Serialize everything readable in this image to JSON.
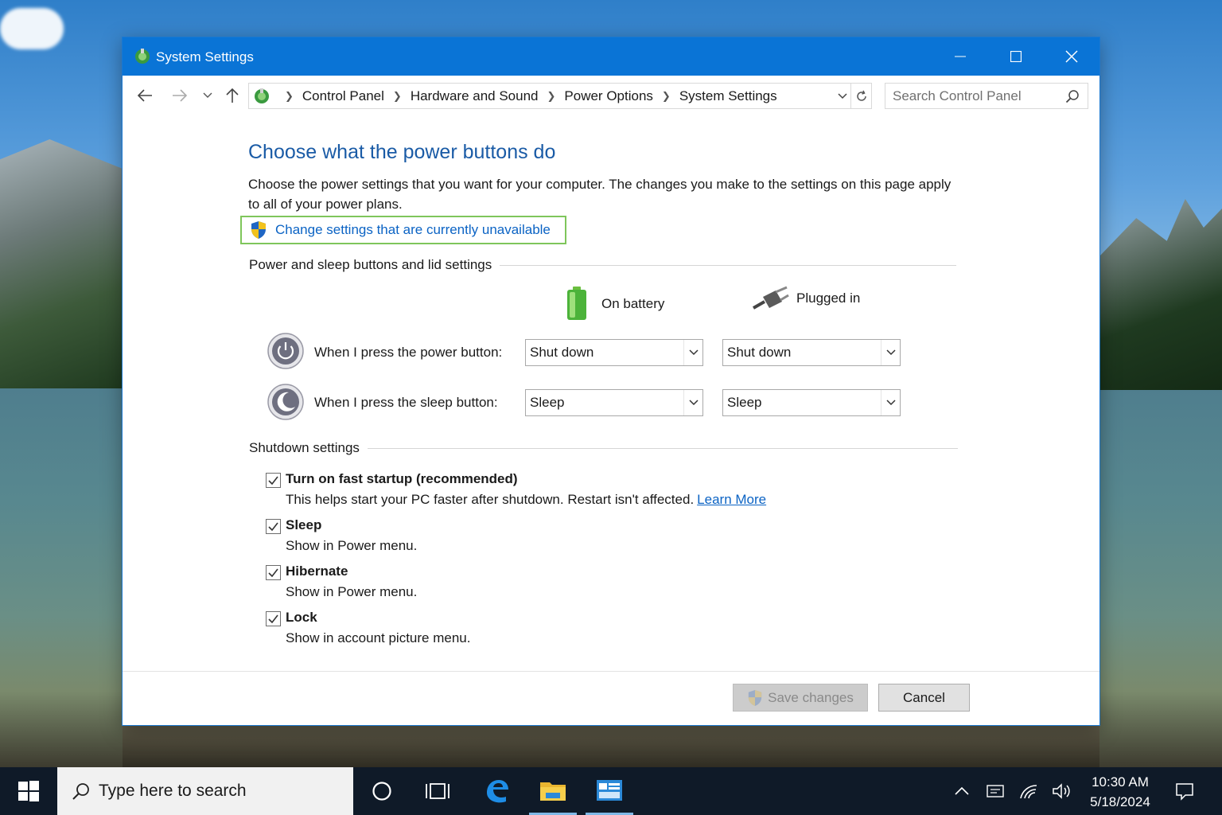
{
  "window": {
    "title": "System Settings",
    "controls": {
      "minimize": "minimize",
      "maximize": "maximize",
      "close": "close"
    }
  },
  "address_bar": {
    "breadcrumbs": [
      "Control Panel",
      "Hardware and Sound",
      "Power Options",
      "System Settings"
    ],
    "search_placeholder": "Search Control Panel"
  },
  "page": {
    "title": "Choose what the power buttons do",
    "intro": "Choose the power settings that you want for your computer. The changes you make to the settings on this page apply to all of your power plans.",
    "uac_link": "Change settings that are currently unavailable",
    "buttons_section": {
      "heading": "Power and sleep buttons and lid settings",
      "col_battery": "On battery",
      "col_plugged": "Plugged in",
      "rows": [
        {
          "label": "When I press the power button:",
          "battery": "Shut down",
          "plugged": "Shut down"
        },
        {
          "label": "When I press the sleep button:",
          "battery": "Sleep",
          "plugged": "Sleep"
        }
      ]
    },
    "shutdown_section": {
      "heading": "Shutdown settings",
      "options": [
        {
          "label": "Turn on fast startup (recommended)",
          "desc": "This helps start your PC faster after shutdown. Restart isn't affected.",
          "link": "Learn More",
          "checked": true
        },
        {
          "label": "Sleep",
          "desc": "Show in Power menu.",
          "checked": true
        },
        {
          "label": "Hibernate",
          "desc": "Show in Power menu.",
          "checked": true
        },
        {
          "label": "Lock",
          "desc": "Show in account picture menu.",
          "checked": true
        }
      ]
    },
    "save_button": "Save changes",
    "cancel_button": "Cancel"
  },
  "taskbar": {
    "search_placeholder": "Type here to search",
    "time": "10:30 AM",
    "date": "5/18/2024"
  },
  "colors": {
    "titlebar": "#0a74d6",
    "heading_blue": "#1a5ba6",
    "link_blue": "#0b63c4",
    "uac_border": "#7fc65b",
    "taskbar": "#0f1a28"
  }
}
